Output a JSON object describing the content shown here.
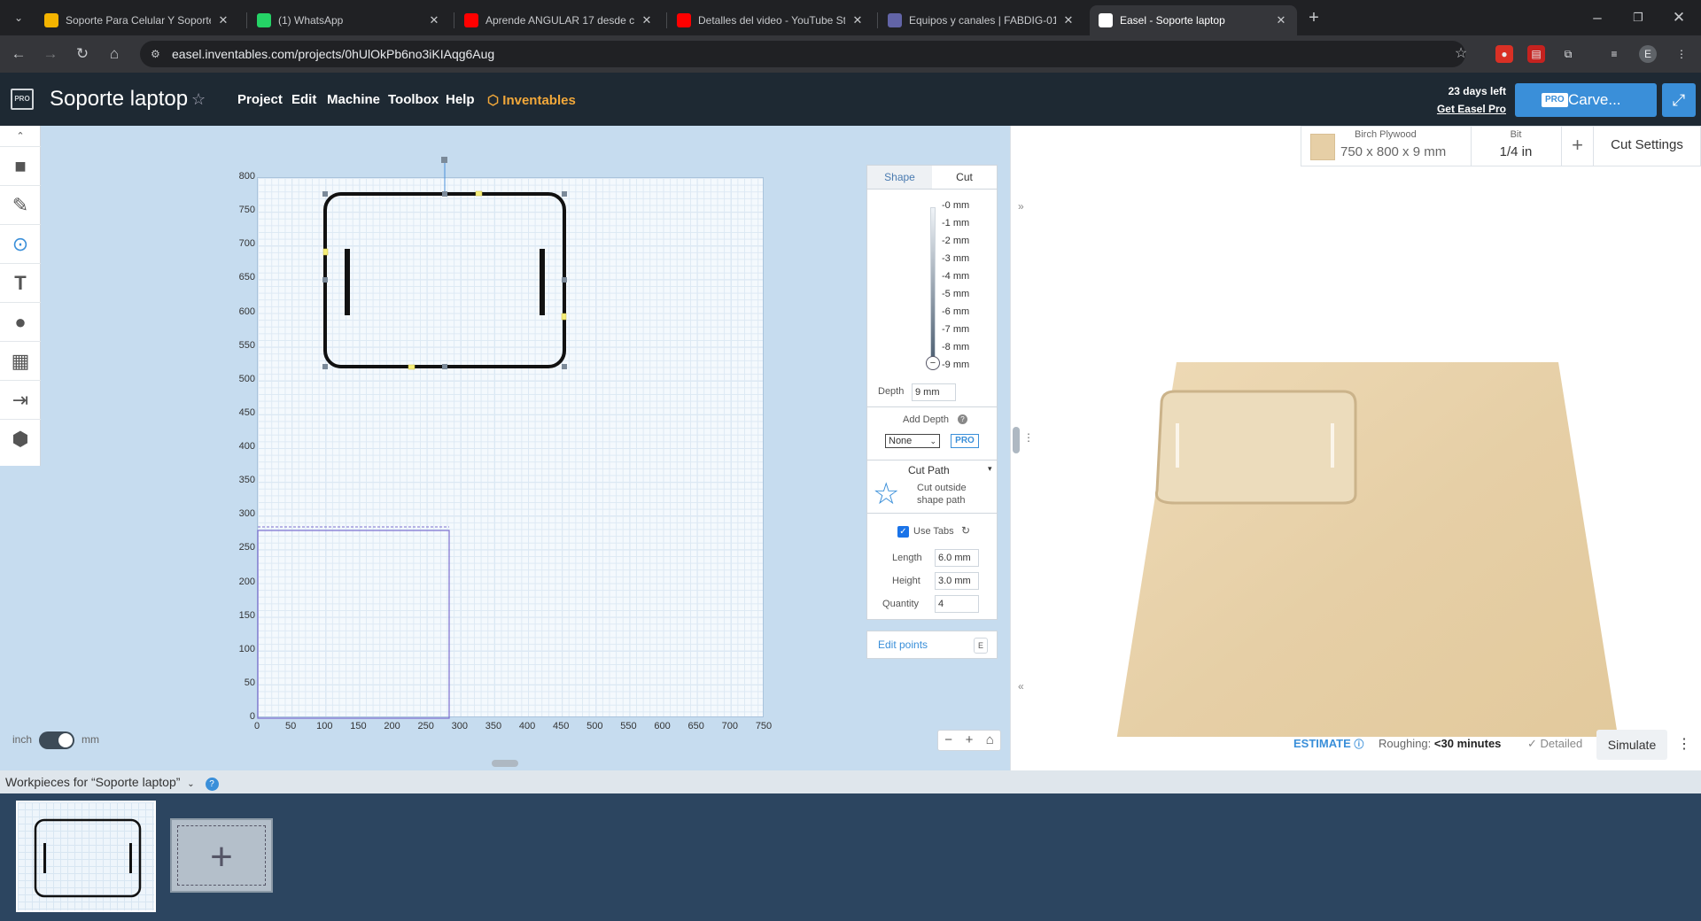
{
  "browser": {
    "tabs": [
      {
        "title": "Soporte Para Celular Y Soporte",
        "icon": "slides-icon",
        "color": "#f4b400"
      },
      {
        "title": "(1) WhatsApp",
        "icon": "whatsapp-icon",
        "color": "#25d366"
      },
      {
        "title": "Aprende ANGULAR 17 desde c",
        "icon": "youtube-icon",
        "color": "#ff0000"
      },
      {
        "title": "Detalles del video - YouTube St",
        "icon": "youtube-icon",
        "color": "#ff0000"
      },
      {
        "title": "Equipos y canales | FABDIG-01",
        "icon": "teams-icon",
        "color": "#6264a7"
      },
      {
        "title": "Easel - Soporte laptop",
        "icon": "easel-icon",
        "color": "#ffffff"
      }
    ],
    "url": "easel.inventables.com/projects/0hUlOkPb6no3iKIAqg6Aug",
    "profile_initial": "E"
  },
  "app": {
    "logo": "PRO",
    "project_name": "Soporte laptop",
    "menu": [
      "Project",
      "Edit",
      "Machine",
      "Toolbox",
      "Help"
    ],
    "brand": "Inventables",
    "days_left": "23 days left",
    "get_pro": "Get Easel Pro",
    "carve_badge": "PRO",
    "carve_label": "Carve...",
    "accent": "#3a8fd9"
  },
  "canvas": {
    "y_ticks": [
      "800",
      "750",
      "700",
      "650",
      "600",
      "550",
      "500",
      "450",
      "400",
      "350",
      "300",
      "250",
      "200",
      "150",
      "100",
      "50",
      "0"
    ],
    "x_ticks": [
      "0",
      "50",
      "100",
      "150",
      "200",
      "250",
      "300",
      "350",
      "400",
      "450",
      "500",
      "550",
      "600",
      "650",
      "700",
      "750"
    ],
    "units_left": "inch",
    "units_right": "mm"
  },
  "panel": {
    "tab_shape": "Shape",
    "tab_cut": "Cut",
    "depth_marks": [
      "-0 mm",
      "-1 mm",
      "-2 mm",
      "-3 mm",
      "-4 mm",
      "-5 mm",
      "-6 mm",
      "-7 mm",
      "-8 mm",
      "-9 mm"
    ],
    "depth_label": "Depth",
    "depth_value": "9 mm",
    "add_depth_label": "Add Depth",
    "add_depth_select": "None",
    "pro_badge": "PRO",
    "cut_path_label": "Cut Path",
    "cut_path_value": "Cut outside shape path",
    "use_tabs_label": "Use Tabs",
    "length_label": "Length",
    "length_value": "6.0 mm",
    "height_label": "Height",
    "height_value": "3.0 mm",
    "quantity_label": "Quantity",
    "quantity_value": "4",
    "edit_points_label": "Edit points",
    "edit_points_key": "E"
  },
  "preview": {
    "material_name": "Birch Plywood",
    "material_size": "750 x 800 x 9 mm",
    "bit_label": "Bit",
    "bit_value": "1/4 in",
    "add_label": "+",
    "cut_settings": "Cut Settings",
    "estimate_label": "ESTIMATE",
    "roughing_label": "Roughing:",
    "roughing_value": "<30 minutes",
    "detailed_label": "Detailed",
    "simulate_label": "Simulate"
  },
  "workpieces": {
    "header": "Workpieces for “Soporte laptop”"
  }
}
